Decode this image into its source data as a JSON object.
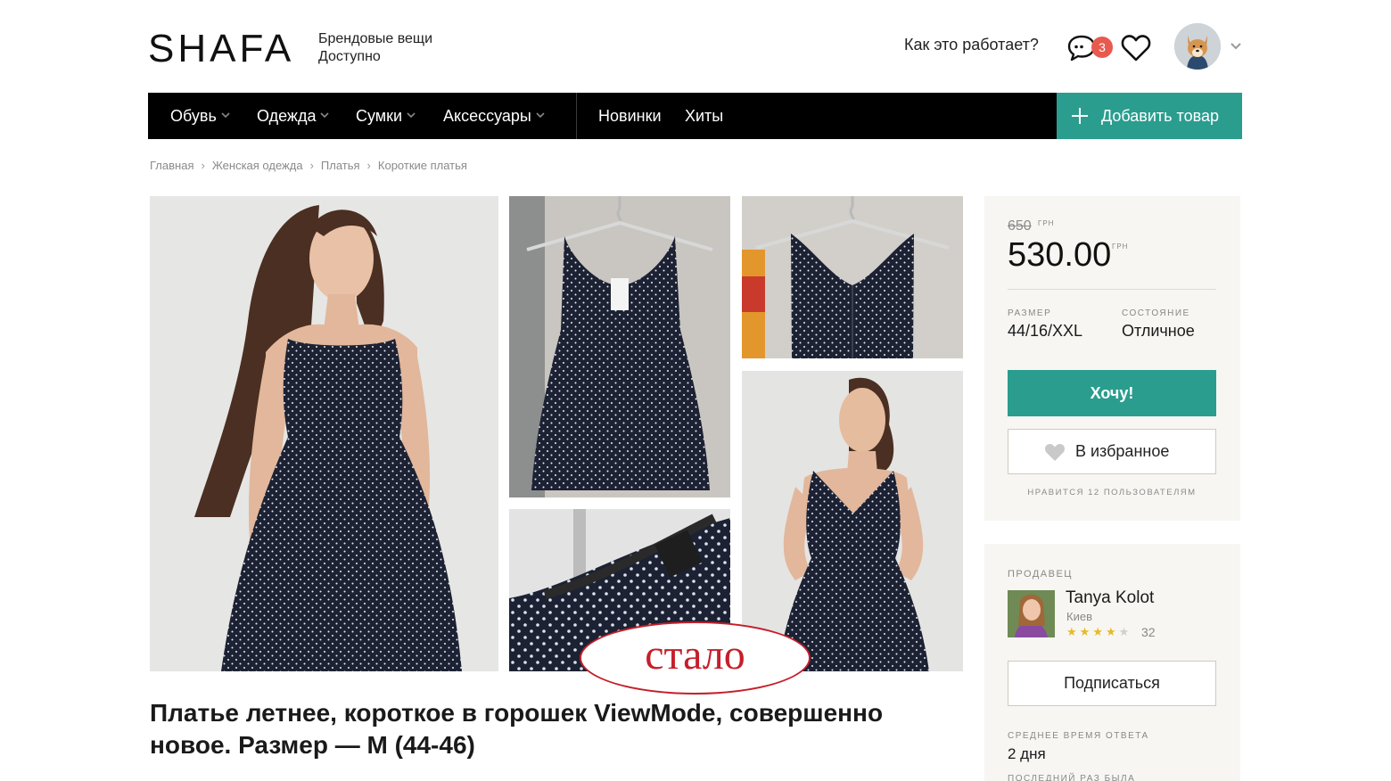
{
  "header": {
    "logo": "SHAFA",
    "tagline_line1": "Брендовые вещи",
    "tagline_line2": "Доступно",
    "how_it_works": "Как это работает?",
    "messages_count": "3"
  },
  "nav": {
    "items": [
      {
        "label": "Обувь",
        "dropdown": true
      },
      {
        "label": "Одежда",
        "dropdown": true
      },
      {
        "label": "Сумки",
        "dropdown": true
      },
      {
        "label": "Аксессуары",
        "dropdown": true
      },
      {
        "label": "Новинки",
        "dropdown": false
      },
      {
        "label": "Хиты",
        "dropdown": false
      }
    ],
    "add_button": "Добавить товар"
  },
  "breadcrumb": [
    "Главная",
    "Женская одежда",
    "Платья",
    "Короткие платья"
  ],
  "product": {
    "title": "Платье летнее, короткое в горошек ViewMode, совершенно новое. Размер — M (44-46)",
    "old_price": "650",
    "price": "530.00",
    "currency": "ГРН",
    "size_label": "Размер",
    "size_value": "44/16/XXL",
    "condition_label": "Состояние",
    "condition_value": "Отличное",
    "want_button": "Хочу!",
    "favorite_button": "В избранное",
    "likes_text": "Нравится 12 пользователям"
  },
  "seller": {
    "label": "Продавец",
    "name": "Tanya Kolot",
    "city": "Киев",
    "rating": 4,
    "rating_max": 5,
    "reviews": "32",
    "subscribe_button": "Подписаться",
    "response_label": "Среднее время ответа",
    "response_value": "2 дня",
    "last_visit_label": "Последний раз была"
  },
  "overlay": {
    "stamp_text": "стало"
  },
  "colors": {
    "accent": "#2a9d8f",
    "nav_bg": "#000000",
    "badge": "#e85a4f",
    "stamp": "#c41f2a",
    "card_bg": "#f7f6f3",
    "dress": "#1c2233"
  }
}
